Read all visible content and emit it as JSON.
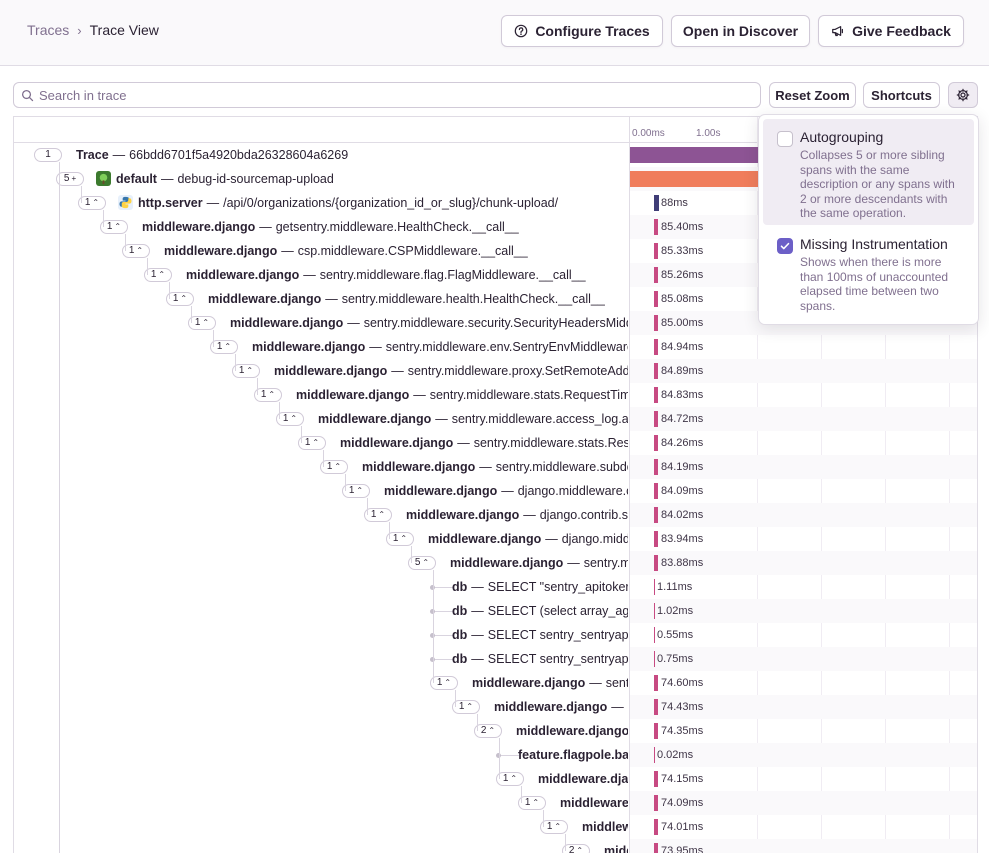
{
  "breadcrumb": {
    "parent": "Traces",
    "current": "Trace View"
  },
  "header_buttons": {
    "configure": "Configure Traces",
    "discover": "Open in Discover",
    "feedback": "Give Feedback"
  },
  "search": {
    "placeholder": "Search in trace",
    "value": ""
  },
  "toolbar": {
    "reset_zoom": "Reset Zoom",
    "shortcuts": "Shortcuts"
  },
  "timeline": {
    "ticks": [
      "0.00ms",
      "1.00s"
    ]
  },
  "settings_menu": {
    "autogrouping": {
      "title": "Autogrouping",
      "description": "Collapses 5 or more sibling spans with the same description or any spans with 2 or more descendants with the same operation.",
      "checked": false
    },
    "missing_instrumentation": {
      "title": "Missing Instrumentation",
      "description": "Shows when there is more than 100ms of unaccounted elapsed time between two spans.",
      "checked": true
    }
  },
  "colors": {
    "accent": "#6c5fc7",
    "trace_bar": "#8d5494",
    "default_bar": "#f07d5c",
    "span_bar": "#c74a82",
    "http_bar": "#3f3d77"
  },
  "rows": [
    {
      "depth": 0,
      "count": "1",
      "chev": "",
      "op": "Trace",
      "desc": "66bdd6701f5a4920bda26328604a6269",
      "dur": "",
      "bar": "trace",
      "icon": ""
    },
    {
      "depth": 1,
      "count": "5",
      "chev": "+",
      "op": "default",
      "desc": "debug-id-sourcemap-upload",
      "dur": "",
      "bar": "default",
      "icon": "project-icon"
    },
    {
      "depth": 2,
      "count": "1",
      "chev": "^",
      "op": "http.server",
      "desc": "/api/0/organizations/{organization_id_or_slug}/chunk-upload/",
      "dur": "88ms",
      "bar": "http",
      "icon": "python-icon"
    },
    {
      "depth": 3,
      "count": "1",
      "chev": "^",
      "op": "middleware.django",
      "desc": "getsentry.middleware.HealthCheck.__call__",
      "dur": "85.40ms",
      "bar": "span",
      "icon": ""
    },
    {
      "depth": 4,
      "count": "1",
      "chev": "^",
      "op": "middleware.django",
      "desc": "csp.middleware.CSPMiddleware.__call__",
      "dur": "85.33ms",
      "bar": "span",
      "icon": ""
    },
    {
      "depth": 5,
      "count": "1",
      "chev": "^",
      "op": "middleware.django",
      "desc": "sentry.middleware.flag.FlagMiddleware.__call__",
      "dur": "85.26ms",
      "bar": "span",
      "icon": ""
    },
    {
      "depth": 6,
      "count": "1",
      "chev": "^",
      "op": "middleware.django",
      "desc": "sentry.middleware.health.HealthCheck.__call__",
      "dur": "85.08ms",
      "bar": "span",
      "icon": ""
    },
    {
      "depth": 7,
      "count": "1",
      "chev": "^",
      "op": "middleware.django",
      "desc": "sentry.middleware.security.SecurityHeadersMiddlew",
      "dur": "85.00ms",
      "bar": "span",
      "icon": ""
    },
    {
      "depth": 8,
      "count": "1",
      "chev": "^",
      "op": "middleware.django",
      "desc": "sentry.middleware.env.SentryEnvMiddleware.__",
      "dur": "84.94ms",
      "bar": "span",
      "icon": ""
    },
    {
      "depth": 9,
      "count": "1",
      "chev": "^",
      "op": "middleware.django",
      "desc": "sentry.middleware.proxy.SetRemoteAddrFro",
      "dur": "84.89ms",
      "bar": "span",
      "icon": ""
    },
    {
      "depth": 10,
      "count": "1",
      "chev": "^",
      "op": "middleware.django",
      "desc": "sentry.middleware.stats.RequestTiming",
      "dur": "84.83ms",
      "bar": "span",
      "icon": ""
    },
    {
      "depth": 11,
      "count": "1",
      "chev": "^",
      "op": "middleware.django",
      "desc": "sentry.middleware.access_log.acce",
      "dur": "84.72ms",
      "bar": "span",
      "icon": ""
    },
    {
      "depth": 12,
      "count": "1",
      "chev": "^",
      "op": "middleware.django",
      "desc": "sentry.middleware.stats.Respo",
      "dur": "84.26ms",
      "bar": "span",
      "icon": ""
    },
    {
      "depth": 13,
      "count": "1",
      "chev": "^",
      "op": "middleware.django",
      "desc": "sentry.middleware.subdoma",
      "dur": "84.19ms",
      "bar": "span",
      "icon": ""
    },
    {
      "depth": 14,
      "count": "1",
      "chev": "^",
      "op": "middleware.django",
      "desc": "django.middleware.com",
      "dur": "84.09ms",
      "bar": "span",
      "icon": ""
    },
    {
      "depth": 15,
      "count": "1",
      "chev": "^",
      "op": "middleware.django",
      "desc": "django.contrib.sess",
      "dur": "84.02ms",
      "bar": "span",
      "icon": ""
    },
    {
      "depth": 16,
      "count": "1",
      "chev": "^",
      "op": "middleware.django",
      "desc": "django.middlew",
      "dur": "83.94ms",
      "bar": "span",
      "icon": ""
    },
    {
      "depth": 17,
      "count": "5",
      "chev": "^",
      "op": "middleware.django",
      "desc": "sentry.midd",
      "dur": "83.88ms",
      "bar": "span",
      "icon": ""
    },
    {
      "depth": 18,
      "count": "",
      "chev": "",
      "op": "db",
      "desc": "SELECT \"sentry_apitoker",
      "dur": "1.11ms",
      "bar": "thin",
      "icon": ""
    },
    {
      "depth": 18,
      "count": "",
      "chev": "",
      "op": "db",
      "desc": "SELECT (select array_ag",
      "dur": "1.02ms",
      "bar": "thin",
      "icon": ""
    },
    {
      "depth": 18,
      "count": "",
      "chev": "",
      "op": "db",
      "desc": "SELECT sentry_sentryap",
      "dur": "0.55ms",
      "bar": "thin",
      "icon": ""
    },
    {
      "depth": 18,
      "count": "",
      "chev": "",
      "op": "db",
      "desc": "SELECT sentry_sentryap",
      "dur": "0.75ms",
      "bar": "thin",
      "icon": ""
    },
    {
      "depth": 18,
      "count": "1",
      "chev": "^",
      "op": "middleware.django",
      "desc": "sentry.n",
      "dur": "74.60ms",
      "bar": "span",
      "icon": ""
    },
    {
      "depth": 19,
      "count": "1",
      "chev": "^",
      "op": "middleware.django",
      "desc": "sent",
      "dur": "74.43ms",
      "bar": "span",
      "icon": ""
    },
    {
      "depth": 20,
      "count": "2",
      "chev": "^",
      "op": "middleware.django",
      "desc": "",
      "dur": "74.35ms",
      "bar": "span",
      "icon": ""
    },
    {
      "depth": 21,
      "count": "",
      "chev": "",
      "op": "feature.flagpole.ba",
      "desc": "",
      "dur": "0.02ms",
      "bar": "thin",
      "icon": ""
    },
    {
      "depth": 21,
      "count": "1",
      "chev": "^",
      "op": "middleware.djang",
      "desc": "",
      "dur": "74.15ms",
      "bar": "span",
      "icon": ""
    },
    {
      "depth": 22,
      "count": "1",
      "chev": "^",
      "op": "middleware.dja",
      "desc": "",
      "dur": "74.09ms",
      "bar": "span",
      "icon": ""
    },
    {
      "depth": 23,
      "count": "1",
      "chev": "^",
      "op": "middlewar",
      "desc": "",
      "dur": "74.01ms",
      "bar": "span",
      "icon": ""
    },
    {
      "depth": 24,
      "count": "2",
      "chev": "^",
      "op": "middle",
      "desc": "",
      "dur": "73.95ms",
      "bar": "span",
      "icon": ""
    }
  ]
}
